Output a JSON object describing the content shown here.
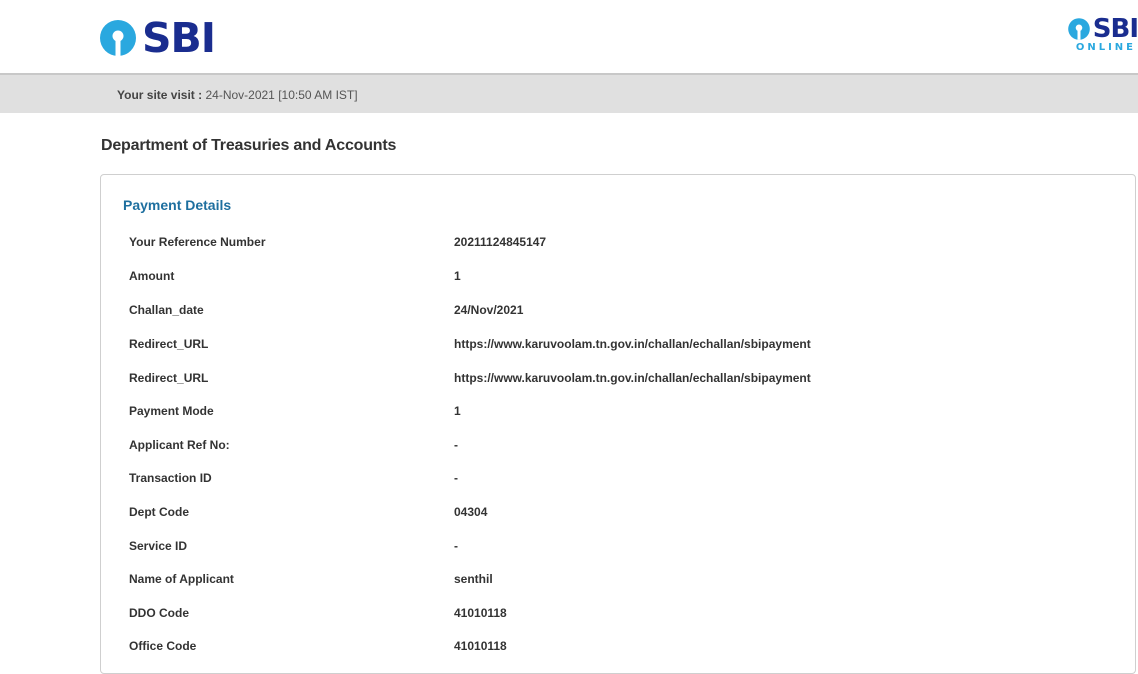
{
  "header": {
    "logo_text": "SBI",
    "online_logo_text": "SBI",
    "online_logo_sub": "ONLINE"
  },
  "visit": {
    "label": "Your site visit :",
    "value": "24-Nov-2021 [10:50 AM IST]"
  },
  "department": "Department of Treasuries and Accounts",
  "payment": {
    "title": "Payment Details",
    "rows": [
      {
        "label": "Your Reference Number",
        "value": "20211124845147"
      },
      {
        "label": "Amount",
        "value": "1"
      },
      {
        "label": "Challan_date",
        "value": "24/Nov/2021"
      },
      {
        "label": "Redirect_URL",
        "value": "https://www.karuvoolam.tn.gov.in/challan/echallan/sbipayment"
      },
      {
        "label": "Redirect_URL",
        "value": "https://www.karuvoolam.tn.gov.in/challan/echallan/sbipayment"
      },
      {
        "label": "Payment Mode",
        "value": "1"
      },
      {
        "label": "Applicant Ref No:",
        "value": "-"
      },
      {
        "label": "Transaction ID",
        "value": "-"
      },
      {
        "label": "Dept Code",
        "value": "04304"
      },
      {
        "label": "Service ID",
        "value": "-"
      },
      {
        "label": "Name of Applicant",
        "value": "senthil"
      },
      {
        "label": "DDO Code",
        "value": "41010118"
      },
      {
        "label": "Office Code",
        "value": "41010118"
      }
    ]
  },
  "colors": {
    "brand_blue": "#1a2d8f",
    "logo_cyan": "#2aa8df",
    "section_title": "#1e6f9f",
    "visit_bar": "#e0e0e0"
  }
}
